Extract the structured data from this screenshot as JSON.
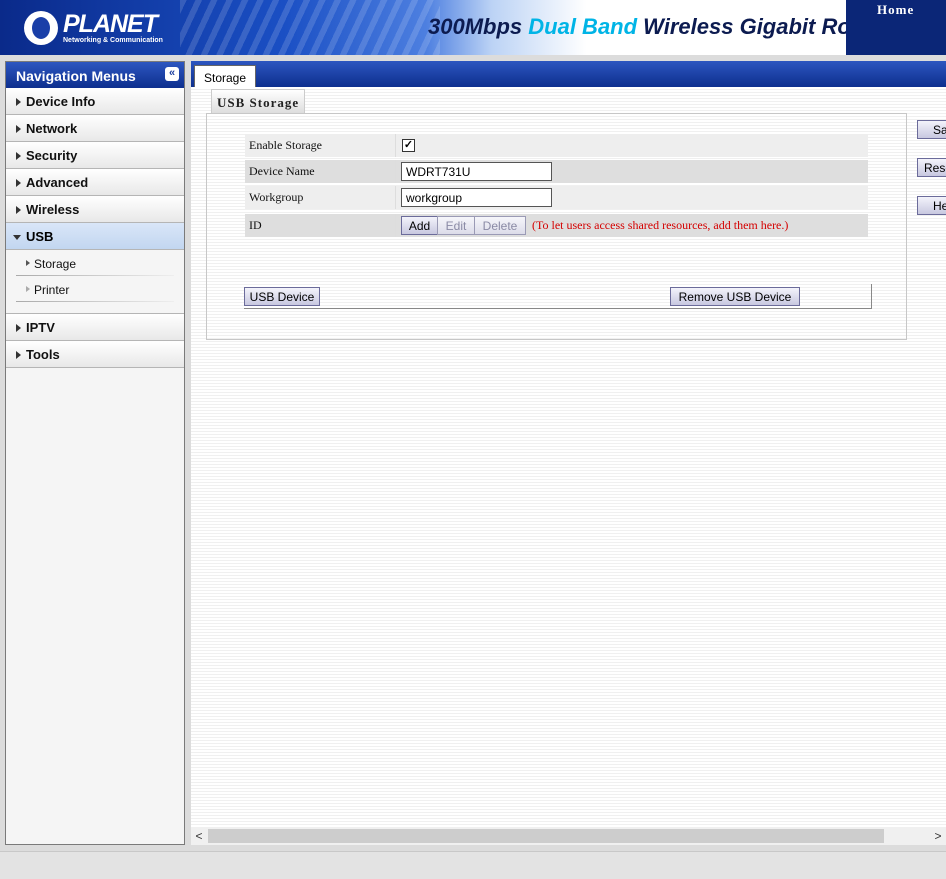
{
  "header": {
    "brand_name": "PLANET",
    "brand_tagline": "Networking & Communication",
    "product_prefix": "300Mbps ",
    "product_highlight": "Dual Band",
    "product_suffix": " Wireless Gigabit Route",
    "home_link": "Home"
  },
  "sidebar": {
    "title": "Navigation Menus",
    "collapse_glyph": "«",
    "items": [
      {
        "label": "Device Info"
      },
      {
        "label": "Network"
      },
      {
        "label": "Security"
      },
      {
        "label": "Advanced"
      },
      {
        "label": "Wireless"
      },
      {
        "label": "USB"
      },
      {
        "label": "IPTV"
      },
      {
        "label": "Tools"
      }
    ],
    "usb_sub": [
      {
        "label": "Storage"
      },
      {
        "label": "Printer"
      }
    ]
  },
  "tabs": {
    "active": "Storage"
  },
  "section": {
    "title": "USB Storage"
  },
  "form": {
    "enable_label": "Enable Storage",
    "enable_checked": "✓",
    "device_name_label": "Device Name",
    "device_name_value": "WDRT731U",
    "workgroup_label": "Workgroup",
    "workgroup_value": "workgroup",
    "id_label": "ID",
    "add_label": "Add",
    "edit_label": "Edit",
    "delete_label": "Delete",
    "hint": "(To let users access shared resources, add them here.)",
    "usb_device_label": "USB Device",
    "remove_usb_label": "Remove USB Device"
  },
  "side_buttons": {
    "save": "Save",
    "reset": "Reset",
    "help": "Help"
  },
  "scrollbar": {
    "left_arrow": "<",
    "right_arrow": ">"
  },
  "colors": {
    "brand_dark": "#0b2677",
    "accent_cyan": "#00b4e6",
    "hint_red": "#d40000"
  }
}
